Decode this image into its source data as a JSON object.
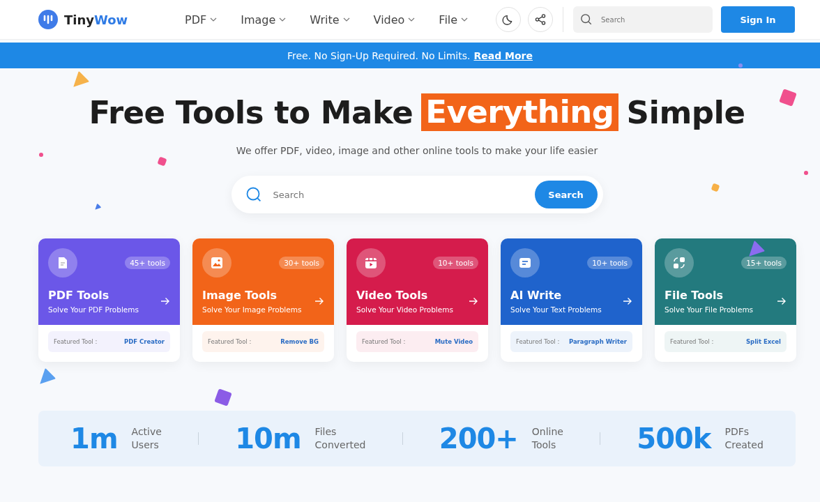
{
  "header": {
    "logo": {
      "first": "Tiny",
      "second": "Wow"
    },
    "nav": [
      {
        "label": "PDF"
      },
      {
        "label": "Image"
      },
      {
        "label": "Write"
      },
      {
        "label": "Video"
      },
      {
        "label": "File"
      }
    ],
    "search": {
      "placeholder": "Search"
    },
    "sign_in": "Sign In"
  },
  "banner": {
    "text": "Free. No Sign-Up Required. No Limits.",
    "link": "Read More"
  },
  "hero": {
    "title_start": "Free Tools to Make",
    "title_highlight": "Everything",
    "title_end": "Simple",
    "subtitle": "We offer PDF, video, image and other online tools to make your life easier",
    "search": {
      "placeholder": "Search",
      "button": "Search"
    }
  },
  "cards": [
    {
      "title": "PDF Tools",
      "subtitle": "Solve Your PDF Problems",
      "count": "45+ tools",
      "color": "#6b57e8",
      "featured_label": "Featured Tool :",
      "featured": "PDF Creator"
    },
    {
      "title": "Image Tools",
      "subtitle": "Solve Your Image Problems",
      "count": "30+ tools",
      "color": "#f26419",
      "featured_label": "Featured Tool :",
      "featured": "Remove BG"
    },
    {
      "title": "Video Tools",
      "subtitle": "Solve Your Video Problems",
      "count": "10+ tools",
      "color": "#d51c4c",
      "featured_label": "Featured Tool :",
      "featured": "Mute Video"
    },
    {
      "title": "AI Write",
      "subtitle": "Solve Your Text Problems",
      "count": "10+ tools",
      "color": "#1f63cc",
      "featured_label": "Featured Tool :",
      "featured": "Paragraph Writer"
    },
    {
      "title": "File Tools",
      "subtitle": "Solve Your File Problems",
      "count": "15+ tools",
      "color": "#237a7e",
      "featured_label": "Featured Tool :",
      "featured": "Split Excel"
    }
  ],
  "stats": [
    {
      "value": "1m",
      "label": "Active Users"
    },
    {
      "value": "10m",
      "label": "Files Converted"
    },
    {
      "value": "200+",
      "label": "Online Tools"
    },
    {
      "value": "500k",
      "label": "PDFs Created"
    }
  ]
}
